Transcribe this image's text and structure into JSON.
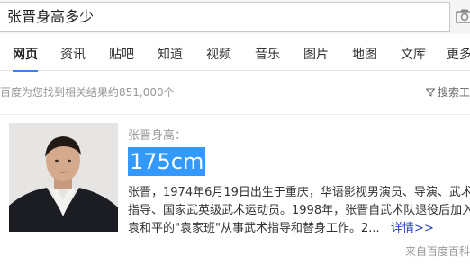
{
  "search": {
    "query": "张晋身高多少"
  },
  "tabs": [
    {
      "label": "网页",
      "active": true
    },
    {
      "label": "资讯"
    },
    {
      "label": "贴吧"
    },
    {
      "label": "知道"
    },
    {
      "label": "视频"
    },
    {
      "label": "音乐"
    },
    {
      "label": "图片"
    },
    {
      "label": "地图"
    },
    {
      "label": "文库"
    },
    {
      "label": "更多"
    }
  ],
  "results": {
    "stats": "百度为您找到相关结果约851,000个",
    "tools_label": "搜索工"
  },
  "answer_card": {
    "question_label": "张晋身高：",
    "answer": "175cm",
    "desc_lines": [
      "张晋，1974年6月19日出生于重庆，华语影视男演员、导演、武术",
      "指导、国家武英级武术运动员。1998年，张晋自武术队退役后加入",
      "袁和平的\"袁家班\"从事武术指导和替身工作。2..."
    ],
    "more_link": "详情>>",
    "source": "来自百度百科"
  },
  "icons": {
    "camera": "camera-icon",
    "filter": "filter-icon"
  },
  "colors": {
    "accent": "#3385ff",
    "highlight": "#3399ff",
    "link": "#2440b3"
  }
}
